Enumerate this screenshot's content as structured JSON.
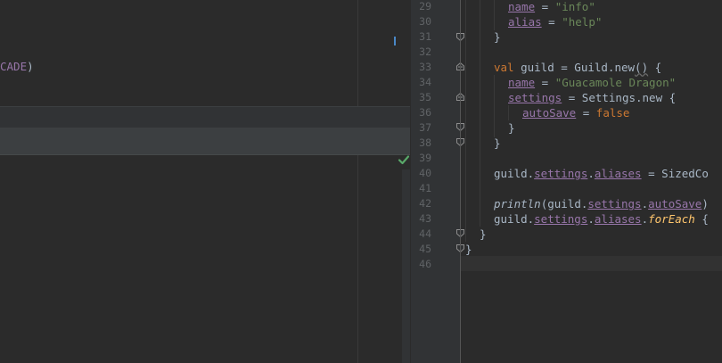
{
  "left_pane": {
    "visible_code": {
      "text_tail": "CADE",
      "close_paren": ")"
    }
  },
  "status": {
    "inspection_ok_icon": "check-icon",
    "color": "#59a869"
  },
  "editor": {
    "line_numbers": [
      "29",
      "30",
      "31",
      "32",
      "33",
      "34",
      "35",
      "36",
      "37",
      "38",
      "39",
      "40",
      "41",
      "42",
      "43",
      "44",
      "45",
      "46"
    ],
    "lines": {
      "l29": {
        "prop": "name",
        "op": " = ",
        "str": "\"info\""
      },
      "l30": {
        "prop": "alias",
        "op": " = ",
        "str": "\"help\""
      },
      "l31": {
        "text": "}"
      },
      "l33": {
        "kw": "val",
        "pre": " guild = Guild.",
        "call": "new",
        "parens": "()",
        "post": " {"
      },
      "l34": {
        "prop": "name",
        "op": " = ",
        "str": "\"Guacamole Dragon\""
      },
      "l35": {
        "prop": "settings",
        "post": " = Settings.new {"
      },
      "l36": {
        "prop": "autoSave",
        "op": " = ",
        "kw": "false"
      },
      "l37": {
        "text": "}"
      },
      "l38": {
        "text": "}"
      },
      "l40": {
        "pre": "guild.",
        "p1": "settings",
        "dot": ".",
        "p2": "aliases",
        "post": " = SizedCo"
      },
      "l42": {
        "fn": "println",
        "pre": "(guild.",
        "p1": "settings",
        "dot": ".",
        "p2": "autoSave",
        "post": ")"
      },
      "l43": {
        "pre": "guild.",
        "p1": "settings",
        "dot": ".",
        "p2": "aliases",
        "dot2": ".",
        "fn": "forEach",
        "post": " {"
      },
      "l44": {
        "text": "}"
      },
      "l45": {
        "text": "}"
      }
    }
  }
}
